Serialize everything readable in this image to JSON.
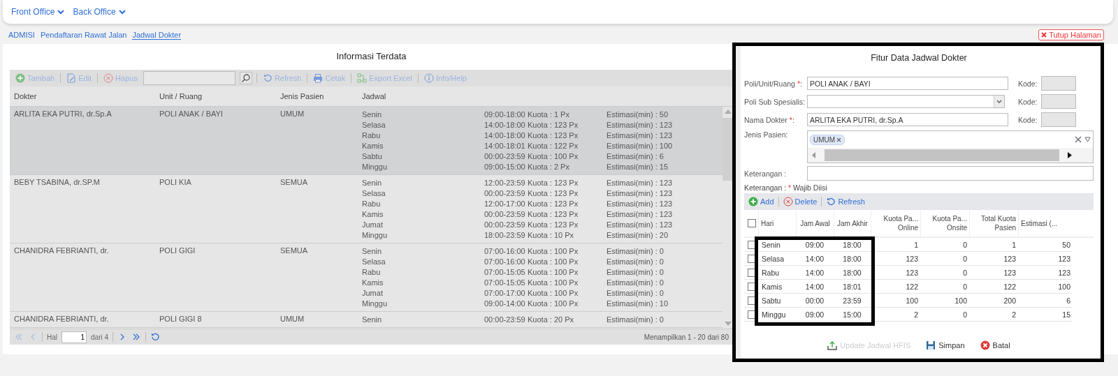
{
  "nav": [
    {
      "label": "Front Office"
    },
    {
      "label": "Back Office"
    }
  ],
  "breadcrumb": [
    {
      "label": "ADMISI",
      "selected": false
    },
    {
      "label": "Pendaftaran Rawat Jalan",
      "selected": false
    },
    {
      "label": "Jadwal Dokter",
      "selected": true
    }
  ],
  "close_button": "Tutup Halaman",
  "list": {
    "title": "Informasi Terdata",
    "toolbar": [
      {
        "kind": "add",
        "label": "Tambah",
        "disabled": true
      },
      {
        "kind": "edit",
        "label": "Edit",
        "disabled": true
      },
      {
        "kind": "delete",
        "label": "Hapus",
        "disabled": true
      },
      {
        "kind": "search",
        "disabled": true
      },
      {
        "kind": "refresh",
        "label": "Refresh",
        "disabled": true
      },
      {
        "kind": "print",
        "label": "Cetak",
        "disabled": true
      },
      {
        "kind": "excel",
        "label": "Export Excel",
        "disabled": true
      },
      {
        "kind": "info",
        "label": "Info/Help",
        "disabled": true
      }
    ],
    "columns": [
      "Dokter",
      "Unit / Ruang",
      "Jenis Pasien",
      "Jadwal"
    ],
    "rows": [
      {
        "selected": true,
        "doctor": "ARLITA EKA PUTRI, dr.Sp.A",
        "unit": "POLI ANAK / BAYI",
        "patient_type": "UMUM",
        "schedule": [
          {
            "day": "Senin",
            "hours": "09:00-18:00",
            "quota": "Kuota : 1 Px",
            "estimate": "Estimasi(min) : 50"
          },
          {
            "day": "Selasa",
            "hours": "14:00-18:00",
            "quota": "Kuota : 123 Px",
            "estimate": "Estimasi(min) : 123"
          },
          {
            "day": "Rabu",
            "hours": "14:00-18:00",
            "quota": "Kuota : 123 Px",
            "estimate": "Estimasi(min) : 123"
          },
          {
            "day": "Kamis",
            "hours": "14:00-18:01",
            "quota": "Kuota : 122 Px",
            "estimate": "Estimasi(min) : 100"
          },
          {
            "day": "Sabtu",
            "hours": "00:00-23:59",
            "quota": "Kuota : 100 Px",
            "estimate": "Estimasi(min) : 6"
          },
          {
            "day": "Minggu",
            "hours": "09:00-15:00",
            "quota": "Kuota : 2 Px",
            "estimate": "Estimasi(min) : 15"
          }
        ]
      },
      {
        "selected": false,
        "doctor": "BEBY TSABINA, dr.SP.M",
        "unit": "POLI KIA",
        "patient_type": "SEMUA",
        "schedule": [
          {
            "day": "Senin",
            "hours": "12:00-23:59",
            "quota": "Kuota : 123 Px",
            "estimate": "Estimasi(min) : 123"
          },
          {
            "day": "Selasa",
            "hours": "00:00-23:59",
            "quota": "Kuota : 123 Px",
            "estimate": "Estimasi(min) : 123"
          },
          {
            "day": "Rabu",
            "hours": "12:00-17:00",
            "quota": "Kuota : 123 Px",
            "estimate": "Estimasi(min) : 123"
          },
          {
            "day": "Kamis",
            "hours": "00:00-23:59",
            "quota": "Kuota : 123 Px",
            "estimate": "Estimasi(min) : 123"
          },
          {
            "day": "Jumat",
            "hours": "00:00-23:59",
            "quota": "Kuota : 123 Px",
            "estimate": "Estimasi(min) : 123"
          },
          {
            "day": "Minggu",
            "hours": "18:00-23:59",
            "quota": "Kuota : 10 Px",
            "estimate": "Estimasi(min) : 20"
          }
        ]
      },
      {
        "selected": false,
        "doctor": "CHANIDRA FEBRIANTI, dr.",
        "unit": "POLI GIGI",
        "patient_type": "SEMUA",
        "schedule": [
          {
            "day": "Senin",
            "hours": "07:00-16:00",
            "quota": "Kuota : 100 Px",
            "estimate": "Estimasi(min) : 0"
          },
          {
            "day": "Selasa",
            "hours": "07:00-16:00",
            "quota": "Kuota : 100 Px",
            "estimate": "Estimasi(min) : 0"
          },
          {
            "day": "Rabu",
            "hours": "07:00-15:05",
            "quota": "Kuota : 100 Px",
            "estimate": "Estimasi(min) : 0"
          },
          {
            "day": "Kamis",
            "hours": "07:00-15:05",
            "quota": "Kuota : 100 Px",
            "estimate": "Estimasi(min) : 0"
          },
          {
            "day": "Jumat",
            "hours": "07:00-17:00",
            "quota": "Kuota : 100 Px",
            "estimate": "Estimasi(min) : 0"
          },
          {
            "day": "Minggu",
            "hours": "09:00-14:00",
            "quota": "Kuota : 100 Px",
            "estimate": "Estimasi(min) : 10"
          }
        ]
      },
      {
        "selected": false,
        "doctor": "CHANIDRA FEBRIANTI, dr.",
        "unit": "POLI GIGI 8",
        "patient_type": "UMUM",
        "schedule": [
          {
            "day": "Senin",
            "hours": "00:00-23:59",
            "quota": "Kuota : 20 Px",
            "estimate": "Estimasi(min) : 0"
          }
        ]
      }
    ],
    "pager": {
      "buttons": [
        {
          "kind": "first",
          "disabled": true
        },
        {
          "kind": "prev",
          "disabled": true
        }
      ],
      "page_label": "Hal",
      "page": "1",
      "of": "dari 4",
      "nav_buttons": [
        {
          "kind": "next",
          "disabled": false
        },
        {
          "kind": "last",
          "disabled": false
        },
        {
          "kind": "reload",
          "disabled": false
        }
      ],
      "summary": "Menampilkan 1 - 20 dari 80"
    }
  },
  "dialog": {
    "title": "Fitur Data Jadwal Dokter",
    "fields": [
      {
        "kind": "text",
        "label": "Poli/Unit/Ruang ",
        "mark": "*",
        "after": ":",
        "value": "POLI ANAK / BAYI",
        "code_label": "Kode:"
      },
      {
        "kind": "select",
        "label": "Poli Sub Spesialis:",
        "code_label": "Kode:"
      },
      {
        "kind": "text",
        "label": "Nama Dokter ",
        "mark": "*",
        "after": ":",
        "value": "ARLITA EKA PUTRI, dr.Sp.A",
        "code_label": "Kode:"
      }
    ],
    "patient_type": {
      "label": "Jenis Pasien:",
      "tags": [
        "UMUM"
      ]
    },
    "note_field": {
      "label": "Keterangan :"
    },
    "required_note": {
      "label": "Keterangan : ",
      "mark": "*",
      "text": " Wajib Diisi"
    },
    "toolbar": [
      {
        "kind": "add",
        "label": "Add"
      },
      {
        "kind": "delete",
        "label": "Delete"
      },
      {
        "kind": "refresh",
        "label": "Refresh"
      }
    ],
    "all_checked": false,
    "columns": [
      {
        "lines": [
          "Hari"
        ]
      },
      {
        "lines": [
          "Jam Awal"
        ]
      },
      {
        "lines": [
          "Jam Akhir"
        ]
      },
      {
        "lines": [
          "Kuota Pa...",
          "Online"
        ]
      },
      {
        "lines": [
          "Kuota Pa...",
          "Onsite"
        ]
      },
      {
        "lines": [
          "Total Kuota",
          "Pasien"
        ]
      },
      {
        "lines": [
          "Estimasi (..."
        ]
      }
    ],
    "rows": [
      {
        "checked": false,
        "cells": [
          "Senin",
          "09:00",
          "18:00",
          "1",
          "0",
          "1",
          "50"
        ]
      },
      {
        "checked": false,
        "cells": [
          "Selasa",
          "14:00",
          "18:00",
          "123",
          "0",
          "123",
          "123"
        ]
      },
      {
        "checked": false,
        "cells": [
          "Rabu",
          "14:00",
          "18:00",
          "123",
          "0",
          "123",
          "123"
        ]
      },
      {
        "checked": false,
        "cells": [
          "Kamis",
          "14:00",
          "18:01",
          "122",
          "0",
          "122",
          "100"
        ]
      },
      {
        "checked": false,
        "cells": [
          "Sabtu",
          "00:00",
          "23:59",
          "100",
          "100",
          "200",
          "6"
        ]
      },
      {
        "checked": false,
        "cells": [
          "Minggu",
          "09:00",
          "15:00",
          "2",
          "0",
          "2",
          "15"
        ]
      }
    ],
    "buttons": [
      {
        "kind": "upload",
        "label": "Update Jadwal HFIS",
        "disabled": true
      },
      {
        "kind": "save",
        "label": "Simpan",
        "disabled": false
      },
      {
        "kind": "cancel",
        "label": "Batal",
        "disabled": false
      }
    ]
  }
}
